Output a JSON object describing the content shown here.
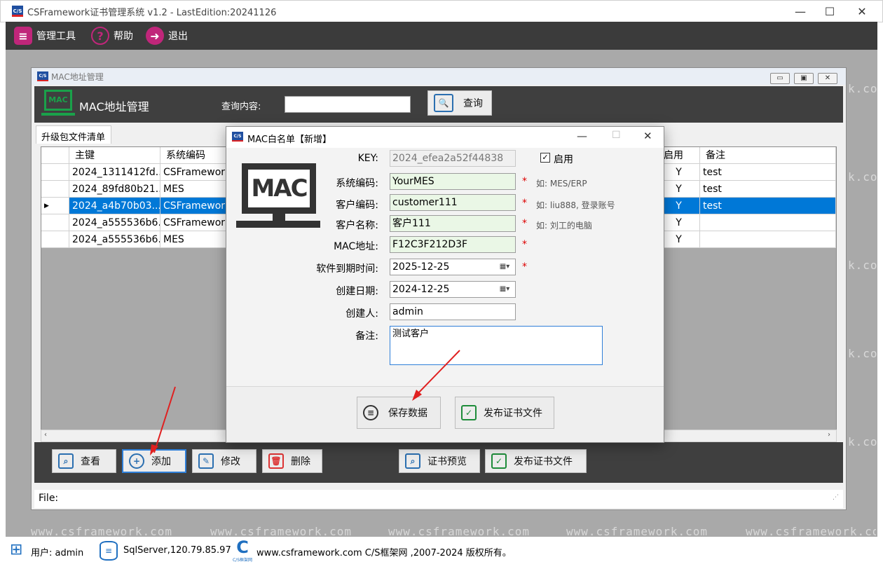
{
  "window": {
    "title": "CSFramework证书管理系统 v1.2 - LastEdition:20241126",
    "logo": "C/S",
    "min": "—",
    "max": "☐",
    "close": "✕"
  },
  "menu": [
    {
      "label": "管理工具",
      "icon": "database-gear-icon",
      "color": "#c0267a"
    },
    {
      "label": "帮助",
      "icon": "question-icon",
      "color": "#c0267a"
    },
    {
      "label": "退出",
      "icon": "exit-icon",
      "color": "#c0267a"
    }
  ],
  "watermark": "www.csframework.com",
  "watermark_short": "k.com",
  "mdi": {
    "title": "MAC地址管理",
    "logo": "C/S",
    "header_logo": "MAC",
    "header_title": "MAC地址管理",
    "search_label": "查询内容:",
    "search_value": "",
    "search_button": "查询",
    "tab": "升级包文件清单",
    "columns": [
      "主键",
      "系统编码",
      "启用",
      "备注"
    ],
    "rows": [
      {
        "key": "2024_1311412fd...",
        "sys": "CSFramework",
        "enabled": "Y",
        "remark": "test",
        "selected": false
      },
      {
        "key": "2024_89fd80b21...",
        "sys": "MES",
        "enabled": "Y",
        "remark": "test",
        "selected": false
      },
      {
        "key": "2024_a4b70b03...",
        "sys": "CSFramework",
        "enabled": "Y",
        "remark": "test",
        "selected": true
      },
      {
        "key": "2024_a555536b6...",
        "sys": "CSFramework",
        "enabled": "Y",
        "remark": "",
        "selected": false
      },
      {
        "key": "2024_a555536b6...",
        "sys": "MES",
        "enabled": "Y",
        "remark": "",
        "selected": false
      }
    ],
    "row_marker": "▶",
    "buttons": {
      "view": "查看",
      "add": "添加",
      "edit": "修改",
      "delete": "删除",
      "preview": "证书预览",
      "publish": "发布证书文件"
    },
    "file_label": "File:"
  },
  "dialog": {
    "title": "MAC白名单【新增】",
    "logo": "C/S",
    "big_logo": "MAC",
    "fields": {
      "key": {
        "label": "KEY:",
        "value": "2024_efea2a52f44838"
      },
      "enabled": {
        "label": "启用",
        "checked": true
      },
      "sys_code": {
        "label": "系统编码:",
        "value": "YourMES",
        "hint": "如: MES/ERP"
      },
      "cust_code": {
        "label": "客户编码:",
        "value": "customer111",
        "hint": "如: liu888, 登录账号"
      },
      "cust_name": {
        "label": "客户名称:",
        "value": "客户111",
        "hint": "如: 刘工的电脑"
      },
      "mac": {
        "label": "MAC地址:",
        "value": "F12C3F212D3F"
      },
      "expire": {
        "label": "软件到期时间:",
        "value": "2025-12-25"
      },
      "created": {
        "label": "创建日期:",
        "value": "2024-12-25"
      },
      "creator": {
        "label": "创建人:",
        "value": "admin"
      },
      "remark": {
        "label": "备注:",
        "value": "测试客户"
      }
    },
    "required_mark": "*",
    "save_button": "保存数据",
    "publish_button": "发布证书文件"
  },
  "statusbar": {
    "user": "用户: admin",
    "db": "SqlServer,120.79.85.97",
    "site": "www.csframework.com C/S框架网 ,2007-2024 版权所有。",
    "logo_caption": "C/S框架网"
  }
}
